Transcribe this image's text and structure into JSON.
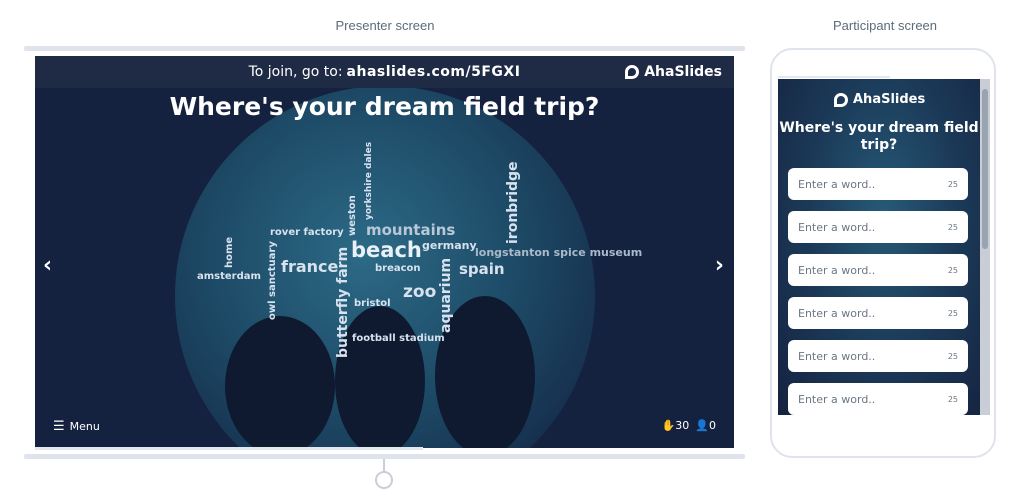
{
  "captions": {
    "presenter": "Presenter screen",
    "participant": "Participant screen"
  },
  "presenter": {
    "join_prefix": "To join, go to:",
    "join_url": "ahaslides.com/5FGXI",
    "brand": "AhaSlides",
    "question": "Where's your dream field trip?",
    "menu_label": "Menu",
    "responses_count": "30",
    "participants_count": "0",
    "nav_prev": "‹",
    "nav_next": "›",
    "words": [
      {
        "text": "beach"
      },
      {
        "text": "mountains"
      },
      {
        "text": "france"
      },
      {
        "text": "spain"
      },
      {
        "text": "zoo"
      },
      {
        "text": "aquarium"
      },
      {
        "text": "butterfly farm"
      },
      {
        "text": "ironbridge"
      },
      {
        "text": "germany"
      },
      {
        "text": "longstanton spice museum"
      },
      {
        "text": "rover factory"
      },
      {
        "text": "breacon"
      },
      {
        "text": "bristol"
      },
      {
        "text": "football stadium"
      },
      {
        "text": "amsterdam"
      },
      {
        "text": "home"
      },
      {
        "text": "owl sanctuary"
      },
      {
        "text": "weston"
      },
      {
        "text": "yorkshire dales"
      }
    ]
  },
  "participant": {
    "brand": "AhaSlides",
    "question": "Where's your dream field trip?",
    "inputs": [
      {
        "placeholder": "Enter a word..",
        "limit": "25"
      },
      {
        "placeholder": "Enter a word..",
        "limit": "25"
      },
      {
        "placeholder": "Enter a word..",
        "limit": "25"
      },
      {
        "placeholder": "Enter a word..",
        "limit": "25"
      },
      {
        "placeholder": "Enter a word..",
        "limit": "25"
      },
      {
        "placeholder": "Enter a word..",
        "limit": "25"
      }
    ]
  },
  "colors": {
    "slide_bg": "#15223f",
    "join_bar": "#1f2b45",
    "text": "#ffffff"
  }
}
